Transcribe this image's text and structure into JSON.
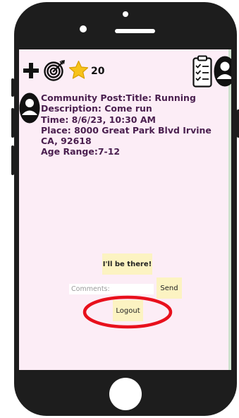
{
  "toolbar": {
    "add_icon": "plus-icon",
    "goal_icon": "target-icon",
    "points_icon": "star-icon",
    "points": "20",
    "tasks_icon": "clipboard-checklist-icon",
    "profile_icon": "user-avatar-icon"
  },
  "post": {
    "line1": "Community Post:Title: Running",
    "line2": "Description: Come run",
    "line3": "Time: 8/6/23, 10:30 AM",
    "line4": "Place: 8000 Great Park Blvd Irvine",
    "line5": "CA, 92618",
    "line6": "Age Range:7-12"
  },
  "actions": {
    "rsvp_label": "I'll be there!",
    "comments_placeholder": "Comments:",
    "send_label": "Send",
    "logout_label": "Logout"
  },
  "colors": {
    "screen_bg": "#fcedf6",
    "button_bg": "#fcf3c2",
    "post_text": "#4a1f4f",
    "highlight_ellipse": "#e8101c",
    "star": "#f7c21a"
  }
}
